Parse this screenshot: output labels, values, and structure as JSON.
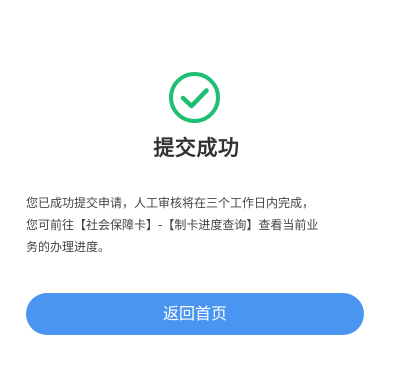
{
  "result": {
    "icon": "check-circle-icon",
    "icon_color": "#1dbf73",
    "title": "提交成功",
    "message_lines": [
      "您已成功提交申请，人工审核将在三个工作日内完成，",
      "您可前往【社会保障卡】-【制卡进度查询】查看当前业",
      "务的办理进度。"
    ]
  },
  "actions": {
    "home_button_label": "返回首页",
    "home_button_color": "#4a95f1"
  }
}
